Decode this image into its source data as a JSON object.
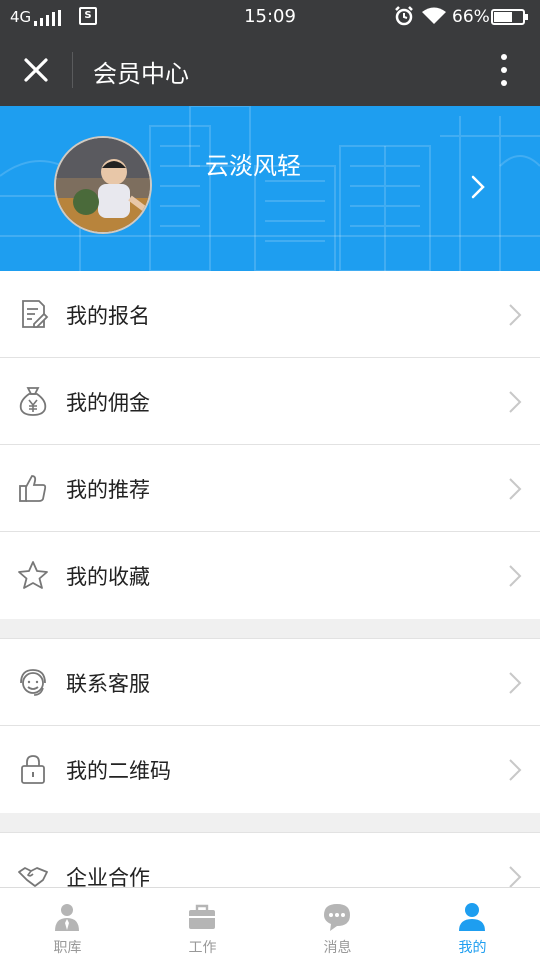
{
  "status_bar": {
    "network": "4G",
    "sim_label": "S",
    "time": "15:09",
    "battery_percent": "66%",
    "battery_level": 0.66
  },
  "header": {
    "title": "会员中心",
    "close_icon": "close-icon",
    "more_icon": "more-vertical-icon"
  },
  "profile": {
    "username": "云淡风轻",
    "background_color": "#1e9ef0"
  },
  "menu": {
    "group1": [
      {
        "label": "我的报名",
        "icon": "signup-form-icon"
      },
      {
        "label": "我的佣金",
        "icon": "money-bag-icon"
      },
      {
        "label": "我的推荐",
        "icon": "thumbs-up-icon"
      },
      {
        "label": "我的收藏",
        "icon": "star-icon"
      }
    ],
    "group2": [
      {
        "label": "联系客服",
        "icon": "customer-service-icon"
      },
      {
        "label": "我的二维码",
        "icon": "lock-icon"
      }
    ],
    "group3": [
      {
        "label": "企业合作",
        "icon": "handshake-icon"
      }
    ]
  },
  "tabbar": {
    "active_color": "#1e9ef0",
    "inactive_color": "#999999",
    "tabs": [
      {
        "label": "职库",
        "icon": "person-tie-icon",
        "active": false
      },
      {
        "label": "工作",
        "icon": "briefcase-icon",
        "active": false
      },
      {
        "label": "消息",
        "icon": "chat-bubble-icon",
        "active": false
      },
      {
        "label": "我的",
        "icon": "person-icon",
        "active": true
      }
    ]
  }
}
